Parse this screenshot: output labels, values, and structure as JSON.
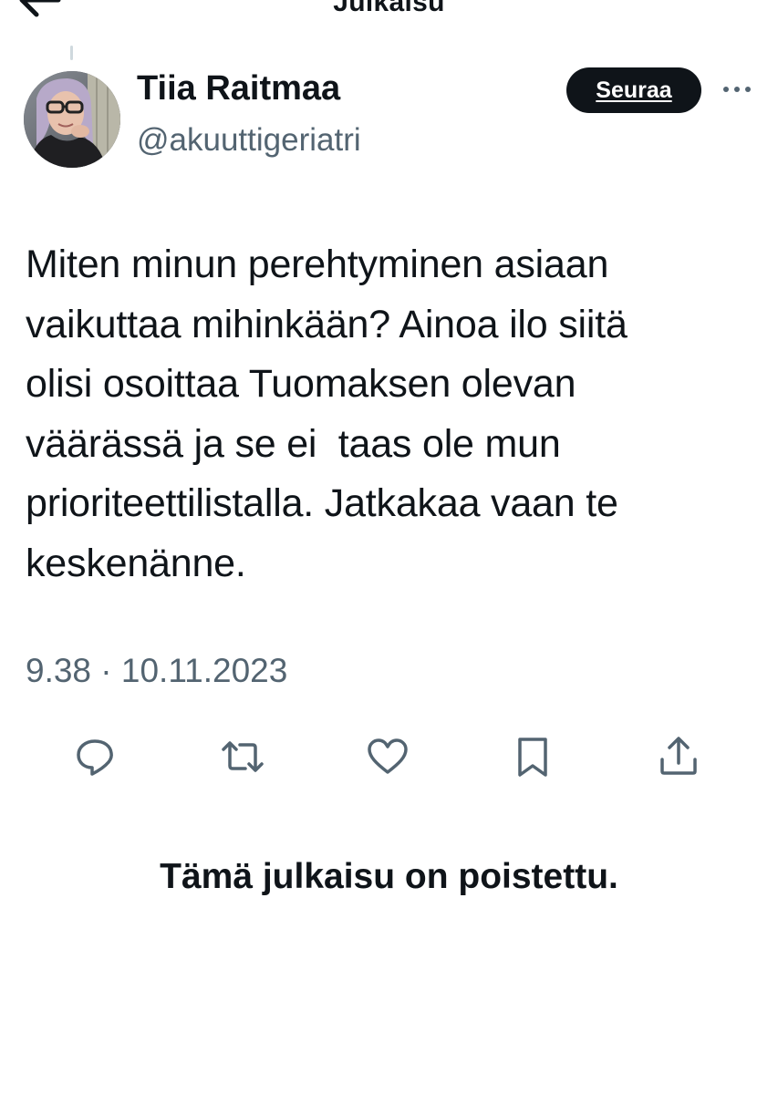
{
  "header": {
    "title": "Julkaisu",
    "back_icon": "arrow-left-icon"
  },
  "author": {
    "display_name": "Tiia Raitmaa",
    "handle": "@akuuttigeriatri",
    "avatar_icon": "avatar-photo",
    "follow_label": "Seuraa",
    "more_icon": "ellipsis-icon"
  },
  "tweet": {
    "text": "Miten minun perehtyminen asiaan\nvaikuttaa mihinkään? Ainoa ilo siitä\nolisi osoittaa Tuomaksen olevan\nväärässä ja se ei  taas ole mun\nprioriteettilistalla. Jatkakaa vaan te\nkeskenänne.",
    "timestamp": "9.38 · 10.11.2023"
  },
  "actions": [
    {
      "name": "reply",
      "icon": "reply-icon"
    },
    {
      "name": "repost",
      "icon": "repost-icon"
    },
    {
      "name": "like",
      "icon": "heart-icon"
    },
    {
      "name": "bookmark",
      "icon": "bookmark-icon"
    },
    {
      "name": "share",
      "icon": "share-icon"
    }
  ],
  "deleted_notice": "Tämä julkaisu on poistettu.",
  "colors": {
    "text_primary": "#0f1419",
    "text_secondary": "#536471",
    "follow_bg": "#0f1419",
    "follow_text": "#ffffff",
    "thread_line": "#cfd9de"
  }
}
